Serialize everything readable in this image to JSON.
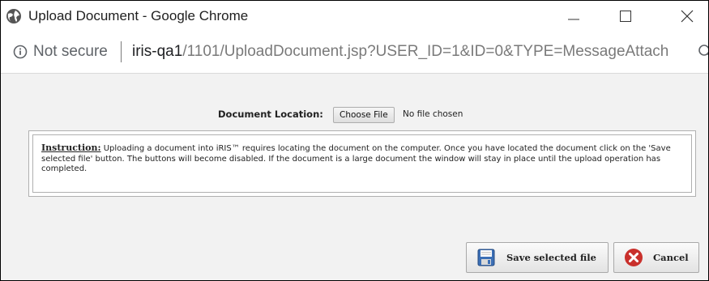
{
  "window": {
    "title": "Upload Document - Google Chrome",
    "minimize_glyph": "—",
    "maximize_glyph": "☐",
    "close_glyph": "✕"
  },
  "addressbar": {
    "security_label": "Not secure",
    "url_host": "iris-qa1",
    "url_path": "/1101/UploadDocument.jsp?USER_ID=1&ID=0&TYPE=MessageAttach"
  },
  "form": {
    "document_location_label": "Document Location:",
    "choose_file_label": "Choose File",
    "file_status": "No file chosen"
  },
  "instruction": {
    "heading": "Instruction:",
    "text": " Uploading a document into iRIS™ requires locating the document on the computer. Once you have located the document click on the 'Save selected file' button. The buttons will become disabled. If the document is a large document the window will stay in place until the upload operation has completed."
  },
  "actions": {
    "save_label": "Save selected file",
    "cancel_label": "Cancel"
  },
  "icons": {
    "browser": "chrome-globe-icon",
    "info": "info-circle-icon",
    "zoom": "zoom-magnifier-icon",
    "save": "floppy-disk-icon",
    "cancel": "red-x-circle-icon"
  },
  "colors": {
    "page_background": "#f2f2f2",
    "cancel_icon": "#c9302c",
    "save_icon_blue": "#3b6fb6",
    "url_path": "#7a7a7a"
  }
}
